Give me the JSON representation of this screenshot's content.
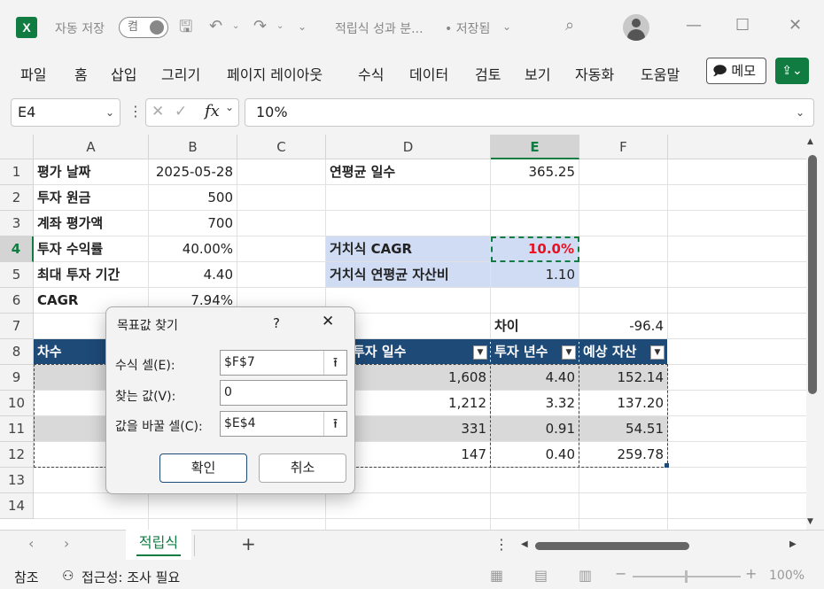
{
  "title": {
    "logo": "X",
    "autosave_label": "자동 저장",
    "autosave_state": "켬",
    "doc_title": "적립식 성과 분...",
    "save_status": "• 저장됨"
  },
  "menu": [
    "파일",
    "홈",
    "삽입",
    "그리기",
    "페이지 레이아웃",
    "수식",
    "데이터",
    "검토",
    "보기",
    "자동화",
    "도움말"
  ],
  "ribbon": {
    "memo": "메모"
  },
  "formula_bar": {
    "namebox": "E4",
    "fx": "fx",
    "value": "10%"
  },
  "columns": [
    "A",
    "B",
    "C",
    "D",
    "E",
    "F"
  ],
  "rows": [
    "1",
    "2",
    "3",
    "4",
    "5",
    "6",
    "7",
    "8",
    "9",
    "10",
    "11",
    "12",
    "13",
    "14"
  ],
  "cells": {
    "A1": "평가 날짜",
    "B1": "2025-05-28",
    "D1": "연평균 일수",
    "E1": "365.25",
    "A2": "투자 원금",
    "B2": "500",
    "A3": "계좌 평가액",
    "B3": "700",
    "A4": "투자 수익률",
    "B4": "40.00%",
    "D4": "거치식 CAGR",
    "E4": "10.0%",
    "A5": "최대 투자 기간",
    "B5": "4.40",
    "D5": "거치식 연평균 자산비",
    "E5": "1.10",
    "A6": "CAGR",
    "B6": "7.94%",
    "E7": "차이",
    "F7": "-96.4",
    "A8": "차수",
    "D8": "투자 일수",
    "E8": "투자 년수",
    "F8": "예상 자산",
    "D9": "1,608",
    "E9": "4.40",
    "F9": "152.14",
    "D10": "1,212",
    "E10": "3.32",
    "F10": "137.20",
    "D11": "331",
    "E11": "0.91",
    "F11": "54.51",
    "D12": "147",
    "E12": "0.40",
    "F12": "259.78"
  },
  "goal_seek": {
    "title": "목표값 찾기",
    "help": "?",
    "set_cell_label": "수식 셀(E):",
    "set_cell": "$F$7",
    "to_value_label": "찾는 값(V):",
    "to_value": "0",
    "changing_label": "값을 바꿀 셀(C):",
    "changing": "$E$4",
    "ok": "확인",
    "cancel": "취소"
  },
  "sheet_tabs": [
    "적립식"
  ],
  "status": {
    "mode": "참조",
    "accessibility": "접근성: 조사 필요",
    "zoom": "100%"
  },
  "colors": {
    "excel_green": "#107c41",
    "table_header": "#1e4a78",
    "highlight_blue": "#cfdcf4",
    "error_red": "#e81123"
  }
}
